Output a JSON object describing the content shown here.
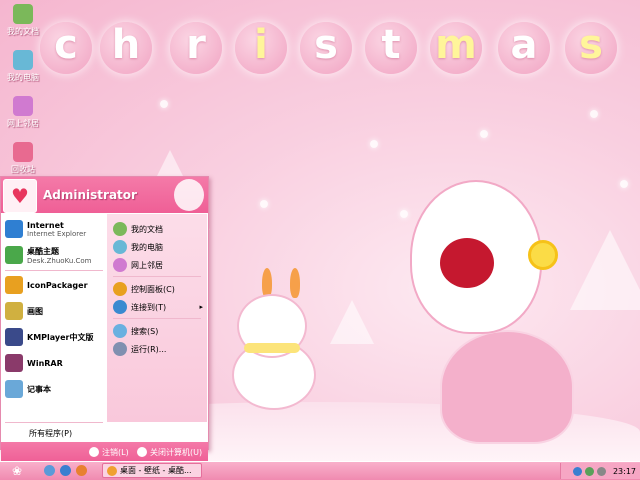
{
  "wallpaper": {
    "title_letters": [
      {
        "ch": "c",
        "yellow": false
      },
      {
        "ch": "h",
        "yellow": false
      },
      {
        "ch": "r",
        "yellow": false
      },
      {
        "ch": "i",
        "yellow": true
      },
      {
        "ch": "s",
        "yellow": false
      },
      {
        "ch": "t",
        "yellow": false
      },
      {
        "ch": "m",
        "yellow": true
      },
      {
        "ch": "a",
        "yellow": false
      },
      {
        "ch": "s",
        "yellow": true
      }
    ]
  },
  "desktop_icons": [
    {
      "label": "我的文档",
      "icon": "documents-folder-icon",
      "color": "#7bb85a"
    },
    {
      "label": "我的电脑",
      "icon": "computer-icon",
      "color": "#68b8d6"
    },
    {
      "label": "网上邻居",
      "icon": "network-icon",
      "color": "#d07ad0"
    },
    {
      "label": "回收站",
      "icon": "recycle-bin-icon",
      "color": "#e86a90"
    }
  ],
  "start_menu": {
    "user_name": "Administrator",
    "left_items": [
      {
        "title": "Internet",
        "subtitle": "Internet Explorer",
        "icon": "internet-explorer-icon",
        "color": "#2f7fd2"
      },
      {
        "title": "桌酷主题",
        "subtitle": "Desk.ZhuoKu.Com",
        "icon": "theme-icon",
        "color": "#4aa84a"
      },
      {
        "title": "IconPackager",
        "subtitle": "",
        "icon": "iconpackager-icon",
        "color": "#e8a020"
      },
      {
        "title": "画图",
        "subtitle": "",
        "icon": "paint-icon",
        "color": "#d0b040"
      },
      {
        "title": "KMPlayer中文版",
        "subtitle": "",
        "icon": "kmplayer-icon",
        "color": "#3a4a8a"
      },
      {
        "title": "WinRAR",
        "subtitle": "",
        "icon": "winrar-icon",
        "color": "#8a3a6a"
      },
      {
        "title": "记事本",
        "subtitle": "",
        "icon": "notepad-icon",
        "color": "#6aa8d8"
      }
    ],
    "all_programs": "所有程序(P)",
    "right_items": [
      {
        "label": "我的文档",
        "icon": "documents-icon",
        "color": "#7bb85a",
        "arrow": ""
      },
      {
        "label": "我的电脑",
        "icon": "computer-icon",
        "color": "#68b8d6",
        "arrow": ""
      },
      {
        "label": "网上邻居",
        "icon": "network-icon",
        "color": "#d07ad0",
        "arrow": ""
      },
      {
        "label": "控制面板(C)",
        "icon": "control-panel-icon",
        "color": "#e8a020",
        "arrow": ""
      },
      {
        "label": "连接到(T)",
        "icon": "connect-icon",
        "color": "#3a8ad0",
        "arrow": "▸"
      },
      {
        "label": "搜索(S)",
        "icon": "search-icon",
        "color": "#6ab0e0",
        "arrow": ""
      },
      {
        "label": "运行(R)...",
        "icon": "run-icon",
        "color": "#8090b0",
        "arrow": ""
      }
    ],
    "footer": {
      "logoff": "注销(L)",
      "shutdown": "关闭计算机(U)"
    }
  },
  "taskbar": {
    "start_glyph": "❀",
    "task_label": "桌面 - 壁纸 - 桌酷...",
    "clock": "23:17"
  }
}
